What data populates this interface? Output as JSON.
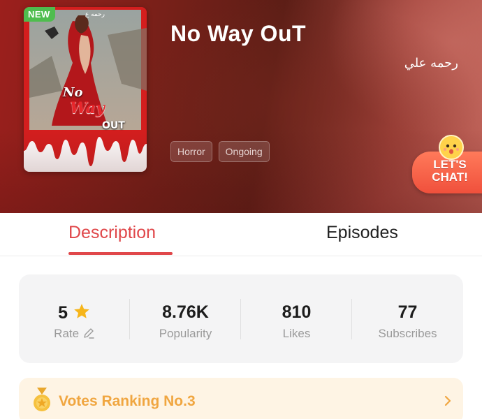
{
  "book": {
    "title": "No Way OuT",
    "author": "رحمه علي",
    "badge": "NEW",
    "cover_author": "رحمه ع",
    "cover_title_lines": [
      "No",
      "Way",
      "OUT"
    ],
    "tags": [
      "Horror",
      "Ongoing"
    ]
  },
  "chat": {
    "line1": "LET'S",
    "line2": "CHAT!"
  },
  "tabs": {
    "description": "Description",
    "episodes": "Episodes",
    "active": "description"
  },
  "stats": {
    "rate": {
      "value": "5",
      "label": "Rate"
    },
    "popularity": {
      "value": "8.76K",
      "label": "Popularity"
    },
    "likes": {
      "value": "810",
      "label": "Likes"
    },
    "subscribes": {
      "value": "77",
      "label": "Subscribes"
    }
  },
  "ranking": {
    "text": "Votes Ranking No.3"
  },
  "colors": {
    "accent": "#e0474a",
    "new_badge": "#4fbd4e",
    "star": "#f6b51a",
    "ranking_text": "#f0a640",
    "ranking_bg": "#fef4e4"
  },
  "icons": {
    "rate_edit": "pencil-icon",
    "rate_star": "star-icon",
    "ranking_medal": "medal-icon",
    "ranking_chevron": "chevron-right-icon"
  }
}
